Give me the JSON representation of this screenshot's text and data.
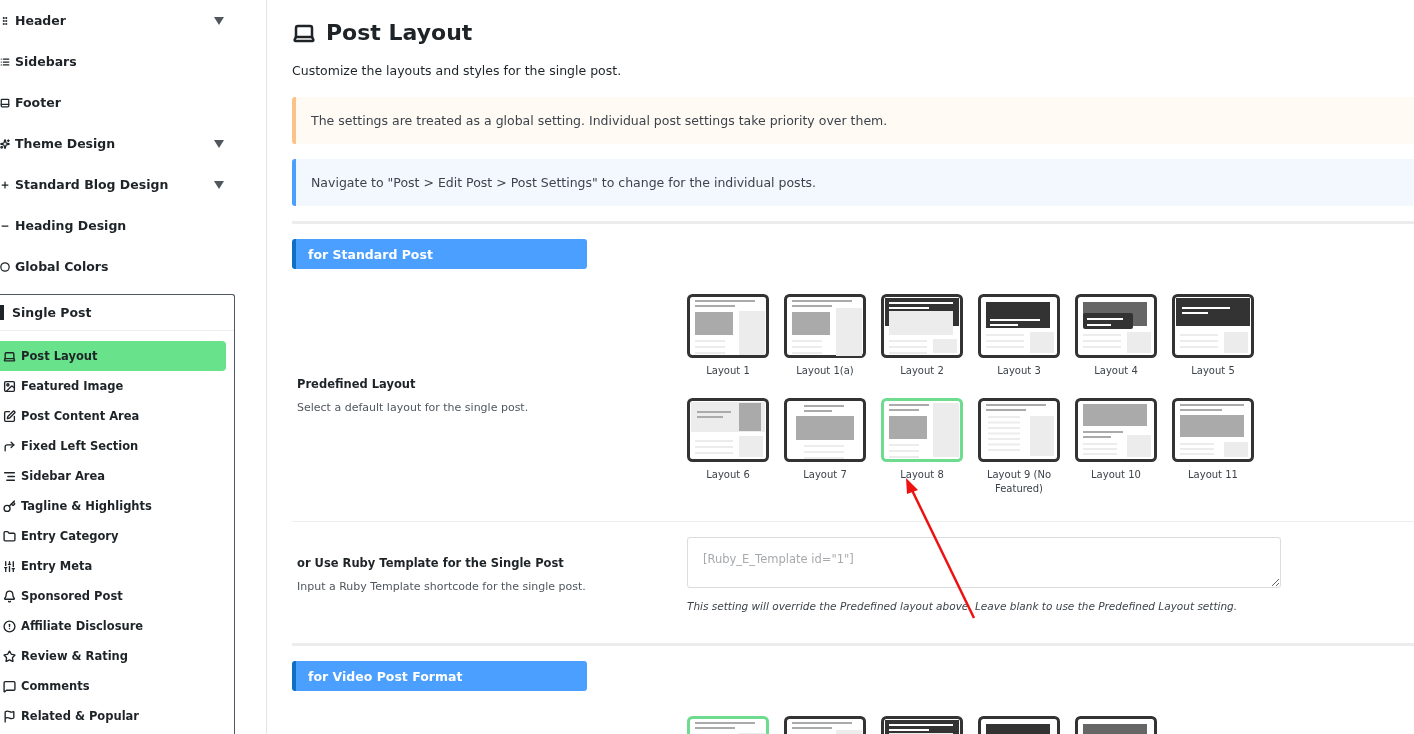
{
  "sidebar": {
    "items": [
      {
        "label": "Header",
        "submenu": true
      },
      {
        "label": "Sidebars",
        "submenu": false
      },
      {
        "label": "Footer",
        "submenu": false
      },
      {
        "label": "Theme Design",
        "submenu": true
      },
      {
        "label": "Standard Blog Design",
        "submenu": true
      },
      {
        "label": "Heading Design",
        "submenu": false
      },
      {
        "label": "Global Colors",
        "submenu": false
      }
    ],
    "group": {
      "label": "Single Post",
      "children": [
        {
          "label": "Post Layout",
          "selected": true
        },
        {
          "label": "Featured Image",
          "selected": false
        },
        {
          "label": "Post Content Area",
          "selected": false
        },
        {
          "label": "Fixed Left Section",
          "selected": false
        },
        {
          "label": "Sidebar Area",
          "selected": false
        },
        {
          "label": "Tagline & Highlights",
          "selected": false
        },
        {
          "label": "Entry Category",
          "selected": false
        },
        {
          "label": "Entry Meta",
          "selected": false
        },
        {
          "label": "Sponsored Post",
          "selected": false
        },
        {
          "label": "Affiliate Disclosure",
          "selected": false
        },
        {
          "label": "Review & Rating",
          "selected": false
        },
        {
          "label": "Comments",
          "selected": false
        },
        {
          "label": "Related & Popular",
          "selected": false
        }
      ]
    }
  },
  "page": {
    "title": "Post Layout",
    "subtitle": "Customize the layouts and styles for the single post.",
    "notices": [
      {
        "kind": "warning",
        "text": "The settings are treated as a global setting. Individual post settings take priority over them."
      },
      {
        "kind": "info",
        "text": "Navigate to \"Post > Edit Post > Post Settings\" to change for the individual posts."
      }
    ]
  },
  "sections": [
    {
      "title": "for Standard Post",
      "settings": [
        {
          "kind": "layouts",
          "label": "Predefined Layout",
          "description": "Select a default layout for the single post.",
          "options": [
            {
              "label": "Layout 1",
              "selected": false
            },
            {
              "label": "Layout 1(a)",
              "selected": false
            },
            {
              "label": "Layout 2",
              "selected": false
            },
            {
              "label": "Layout 3",
              "selected": false
            },
            {
              "label": "Layout 4",
              "selected": false
            },
            {
              "label": "Layout 5",
              "selected": false
            },
            {
              "label": "Layout 6",
              "selected": false
            },
            {
              "label": "Layout 7",
              "selected": false
            },
            {
              "label": "Layout 8",
              "selected": true
            },
            {
              "label": "Layout 9 (No Featured)",
              "selected": false
            },
            {
              "label": "Layout 10",
              "selected": false
            },
            {
              "label": "Layout 11",
              "selected": false
            }
          ]
        },
        {
          "kind": "textarea",
          "label": "or Use Ruby Template for the Single Post",
          "description": "Input a Ruby Template shortcode for the single post.",
          "placeholder": "[Ruby_E_Template id=\"1\"]",
          "note": "This setting will override the Predefined layout above. Leave blank to use the Predefined Layout setting."
        }
      ]
    },
    {
      "title": "for Video Post Format",
      "settings": [
        {
          "kind": "layouts",
          "options": [
            {
              "selected": true
            },
            {
              "selected": false
            },
            {
              "selected": false
            },
            {
              "selected": false
            },
            {
              "selected": false
            }
          ]
        }
      ]
    }
  ]
}
